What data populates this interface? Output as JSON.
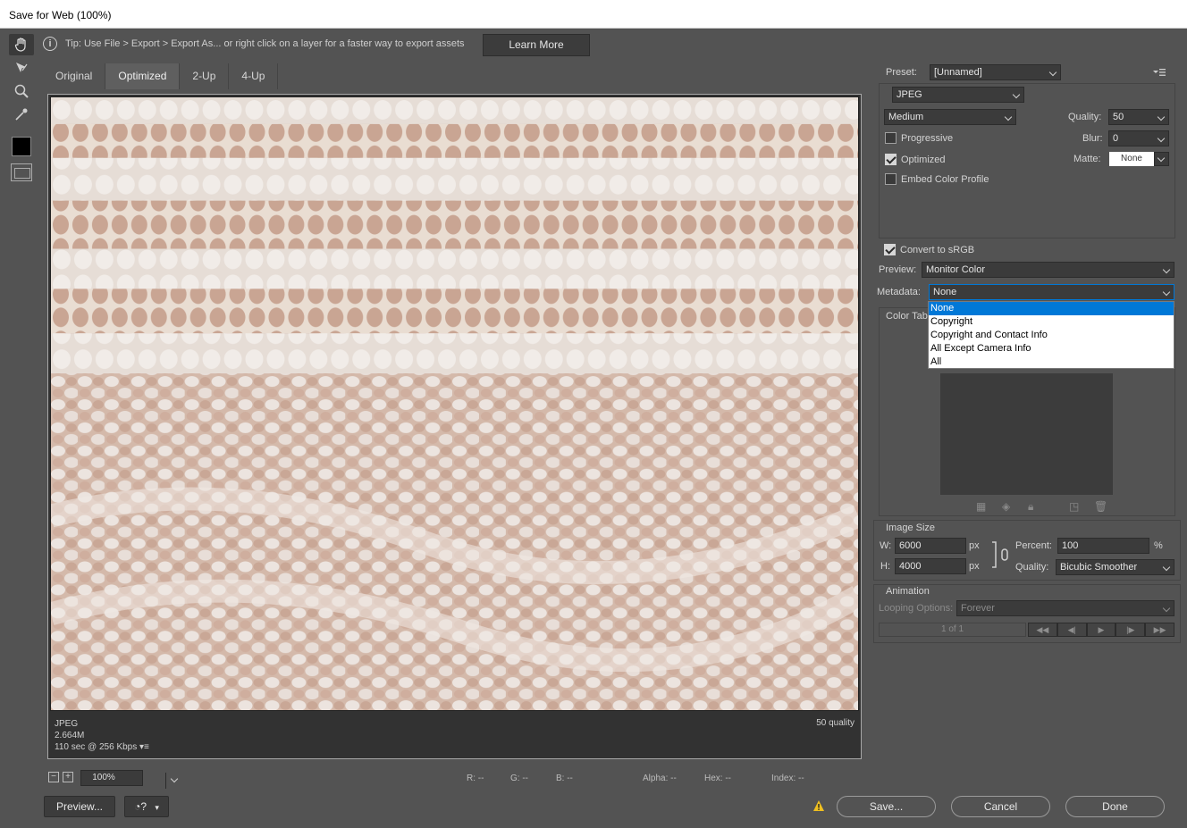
{
  "window": {
    "title": "Save for Web (100%)"
  },
  "tip": {
    "text": "Tip: Use File > Export > Export As...  or right click on a layer for a faster way to export assets",
    "learn_more": "Learn More"
  },
  "tabs": [
    {
      "label": "Original",
      "active": false
    },
    {
      "label": "Optimized",
      "active": true
    },
    {
      "label": "2-Up",
      "active": false
    },
    {
      "label": "4-Up",
      "active": false
    }
  ],
  "image_info": {
    "format": "JPEG",
    "size": "2.664M",
    "download": "110 sec @ 256 Kbps",
    "quality_note": "50 quality"
  },
  "zoom": {
    "value": "100%"
  },
  "readouts": {
    "r": "R: --",
    "g": "G: --",
    "b": "B: --",
    "alpha": "Alpha: --",
    "hex": "Hex: --",
    "index": "Index: --"
  },
  "buttons": {
    "preview": "Preview...",
    "save": "Save...",
    "cancel": "Cancel",
    "done": "Done"
  },
  "settings": {
    "preset_label": "Preset:",
    "preset_value": "[Unnamed]",
    "format_value": "JPEG",
    "quality_level": "Medium",
    "quality_label": "Quality:",
    "quality_value": "50",
    "blur_label": "Blur:",
    "blur_value": "0",
    "matte_label": "Matte:",
    "matte_value": "None",
    "progressive": {
      "label": "Progressive",
      "checked": false
    },
    "optimized": {
      "label": "Optimized",
      "checked": true
    },
    "embed_profile": {
      "label": "Embed Color Profile",
      "checked": false
    },
    "convert_srgb": {
      "label": "Convert to sRGB",
      "checked": true
    },
    "preview_label": "Preview:",
    "preview_value": "Monitor Color",
    "metadata_label": "Metadata:",
    "metadata_value": "None",
    "metadata_options": [
      "None",
      "Copyright",
      "Copyright and Contact Info",
      "All Except Camera Info",
      "All"
    ],
    "color_table_label": "Color Tab"
  },
  "image_size": {
    "title": "Image Size",
    "w_label": "W:",
    "w_value": "6000",
    "h_label": "H:",
    "h_value": "4000",
    "unit": "px",
    "percent_label": "Percent:",
    "percent_value": "100",
    "percent_unit": "%",
    "quality_label": "Quality:",
    "quality_value": "Bicubic Smoother"
  },
  "animation": {
    "title": "Animation",
    "looping_label": "Looping Options:",
    "looping_value": "Forever",
    "frame_counter": "1 of 1"
  },
  "colors": {
    "accent": "#0078d7",
    "bg": "#535353",
    "field": "#3b3b3b"
  }
}
